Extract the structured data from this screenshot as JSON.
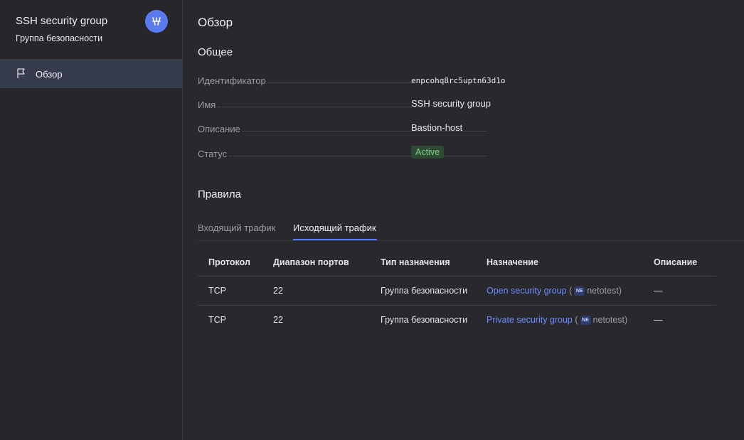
{
  "sidebar": {
    "title": "SSH security group",
    "subtitle": "Группа безопасности",
    "badge_icon": "security-group-icon",
    "items": [
      {
        "label": "Обзор",
        "icon": "flag-icon",
        "active": true
      }
    ]
  },
  "main": {
    "heading": "Обзор",
    "general": {
      "title": "Общее",
      "fields": [
        {
          "key": "Идентификатор",
          "value": "enpcohq8rc5uptn63d1o"
        },
        {
          "key": "Имя",
          "value": "SSH security group"
        },
        {
          "key": "Описание",
          "value": "Bastion-host"
        },
        {
          "key": "Статус",
          "value": "Active"
        }
      ]
    },
    "rules": {
      "title": "Правила",
      "tabs": [
        {
          "label": "Входящий трафик",
          "active": false
        },
        {
          "label": "Исходящий трафик",
          "active": true
        }
      ],
      "columns": [
        "Протокол",
        "Диапазон портов",
        "Тип назначения",
        "Назначение",
        "Описание"
      ],
      "rows": [
        {
          "protocol": "TCP",
          "ports": "22",
          "dest_type": "Группа безопасности",
          "dest_link": "Open security group",
          "folder_badge": "NE",
          "folder": "netotest",
          "description": "—"
        },
        {
          "protocol": "TCP",
          "ports": "22",
          "dest_type": "Группа безопасности",
          "dest_link": "Private security group",
          "folder_badge": "NE",
          "folder": "netotest",
          "description": "—"
        }
      ]
    }
  },
  "colors": {
    "accent": "#5a7af0",
    "link": "#6b8cff",
    "status_bg": "#2f4a33",
    "status_text": "#7fcf84"
  }
}
